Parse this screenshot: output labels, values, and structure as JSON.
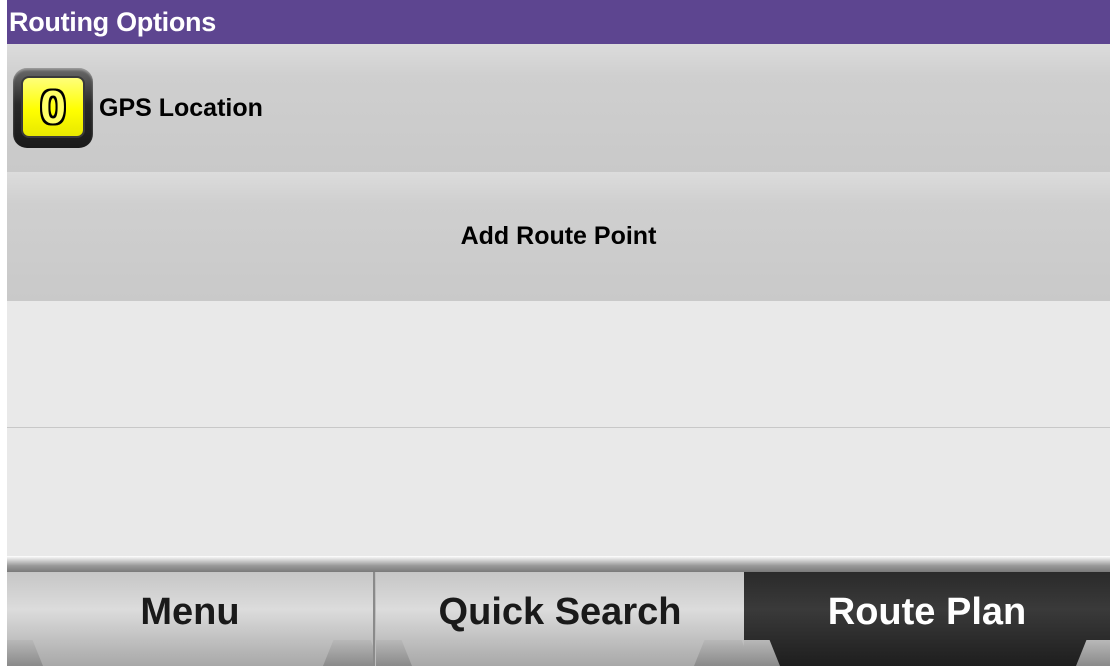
{
  "window": {
    "title": "Routing Options"
  },
  "route_points": {
    "gps": {
      "badge_number": "0",
      "label": "GPS Location",
      "icon": "waypoint-number-badge-icon",
      "badge_color": "#ffff00"
    },
    "add_label": "Add Route Point"
  },
  "bottom_nav": {
    "tabs": [
      {
        "label": "Menu",
        "selected": false
      },
      {
        "label": "Quick Search",
        "selected": false
      },
      {
        "label": "Route Plan",
        "selected": true
      }
    ]
  },
  "colors": {
    "title_bar": "#5d4590",
    "selected_tab": "#2a2a2a"
  }
}
